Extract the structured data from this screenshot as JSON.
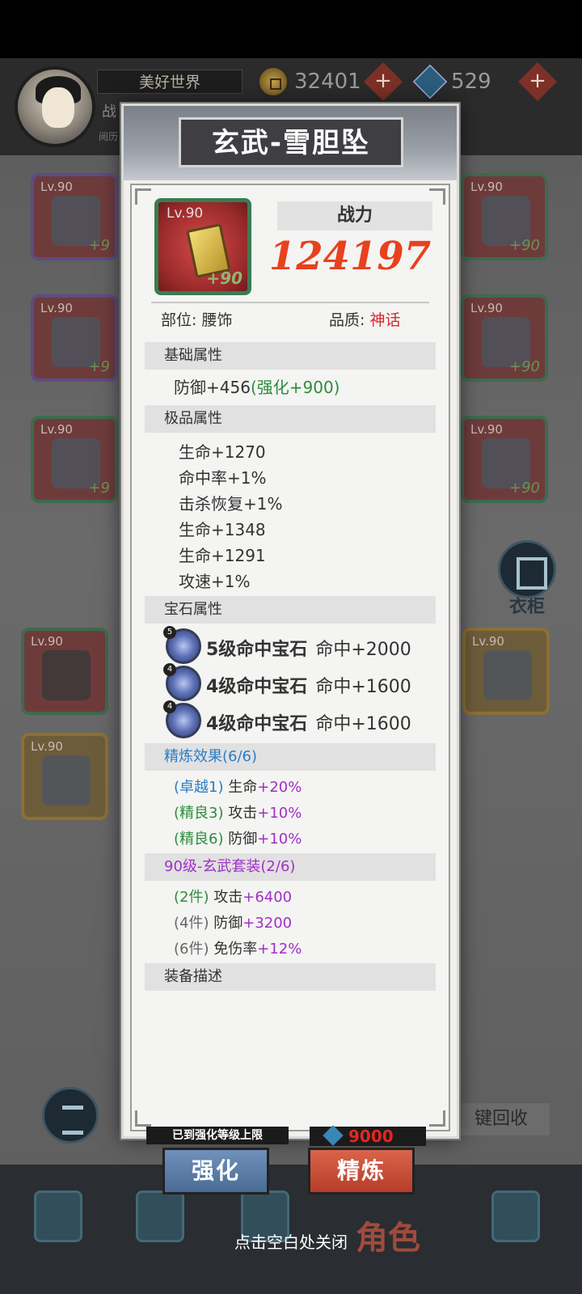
{
  "background": {
    "world_name": "美好世界",
    "power_tag": "战",
    "sub_tag": "阅历",
    "gold": "32401",
    "crystal": "529",
    "plus_symbol": "+",
    "slots": {
      "left": [
        {
          "lv": "Lv.90",
          "plus": "+9"
        },
        {
          "lv": "Lv.90",
          "plus": "+9"
        },
        {
          "lv": "Lv.90",
          "plus": "+9"
        },
        {
          "lv": "Lv.90",
          "plus": ""
        },
        {
          "lv": "Lv.90",
          "plus": ""
        }
      ],
      "right": [
        {
          "lv": "Lv.90",
          "plus": "+90"
        },
        {
          "lv": "Lv.90",
          "plus": "+90"
        },
        {
          "lv": "Lv.90",
          "plus": "+90"
        },
        {
          "lv": "Lv.90",
          "plus": ""
        }
      ]
    },
    "wardrobe_label": "衣柜",
    "sort_label": "3 2 1",
    "recycle_label": "键回收",
    "role_label": "角色",
    "close_hint": "点击空白处关闭"
  },
  "panel": {
    "title": "玄武-雪胆坠",
    "item": {
      "lv": "Lv.90",
      "plus": "+90"
    },
    "power_label": "战力",
    "power_value": "124197",
    "position_key": "部位:",
    "position_value": "腰饰",
    "quality_key": "品质:",
    "quality_value": "神话",
    "sections": {
      "base": "基础属性",
      "premium": "极品属性",
      "gem": "宝石属性",
      "refine": "精炼效果(6/6)",
      "set": "90级-玄武套装(2/6)",
      "desc": "装备描述"
    },
    "base_attr": {
      "stat": "防御+456",
      "enhance": "(强化+900)"
    },
    "premium_attrs": [
      "生命+1270",
      "命中率+1%",
      "击杀恢复+1%",
      "生命+1348",
      "生命+1291",
      "攻速+1%"
    ],
    "gems": [
      {
        "level": "5",
        "name": "5级命中宝石",
        "stat": "命中+2000"
      },
      {
        "level": "4",
        "name": "4级命中宝石",
        "stat": "命中+1600"
      },
      {
        "level": "4",
        "name": "4级命中宝石",
        "stat": "命中+1600"
      }
    ],
    "refine_effects": [
      {
        "tag": "(卓越1)",
        "text": "生命",
        "plus": "+20%"
      },
      {
        "tag": "(精良3)",
        "text": "攻击",
        "plus": "+10%"
      },
      {
        "tag": "(精良6)",
        "text": "防御",
        "plus": "+10%"
      }
    ],
    "set_effects": [
      {
        "tag": "(2件)",
        "text": "攻击",
        "plus": "+6400"
      },
      {
        "tag": "(4件)",
        "text": "防御",
        "plus": "+3200"
      },
      {
        "tag": "(6件)",
        "text": "免伤率",
        "plus": "+12%"
      }
    ],
    "cap_note": "已到强化等级上限",
    "cost": "9000",
    "enhance_button": "强化",
    "refine_button": "精炼"
  }
}
